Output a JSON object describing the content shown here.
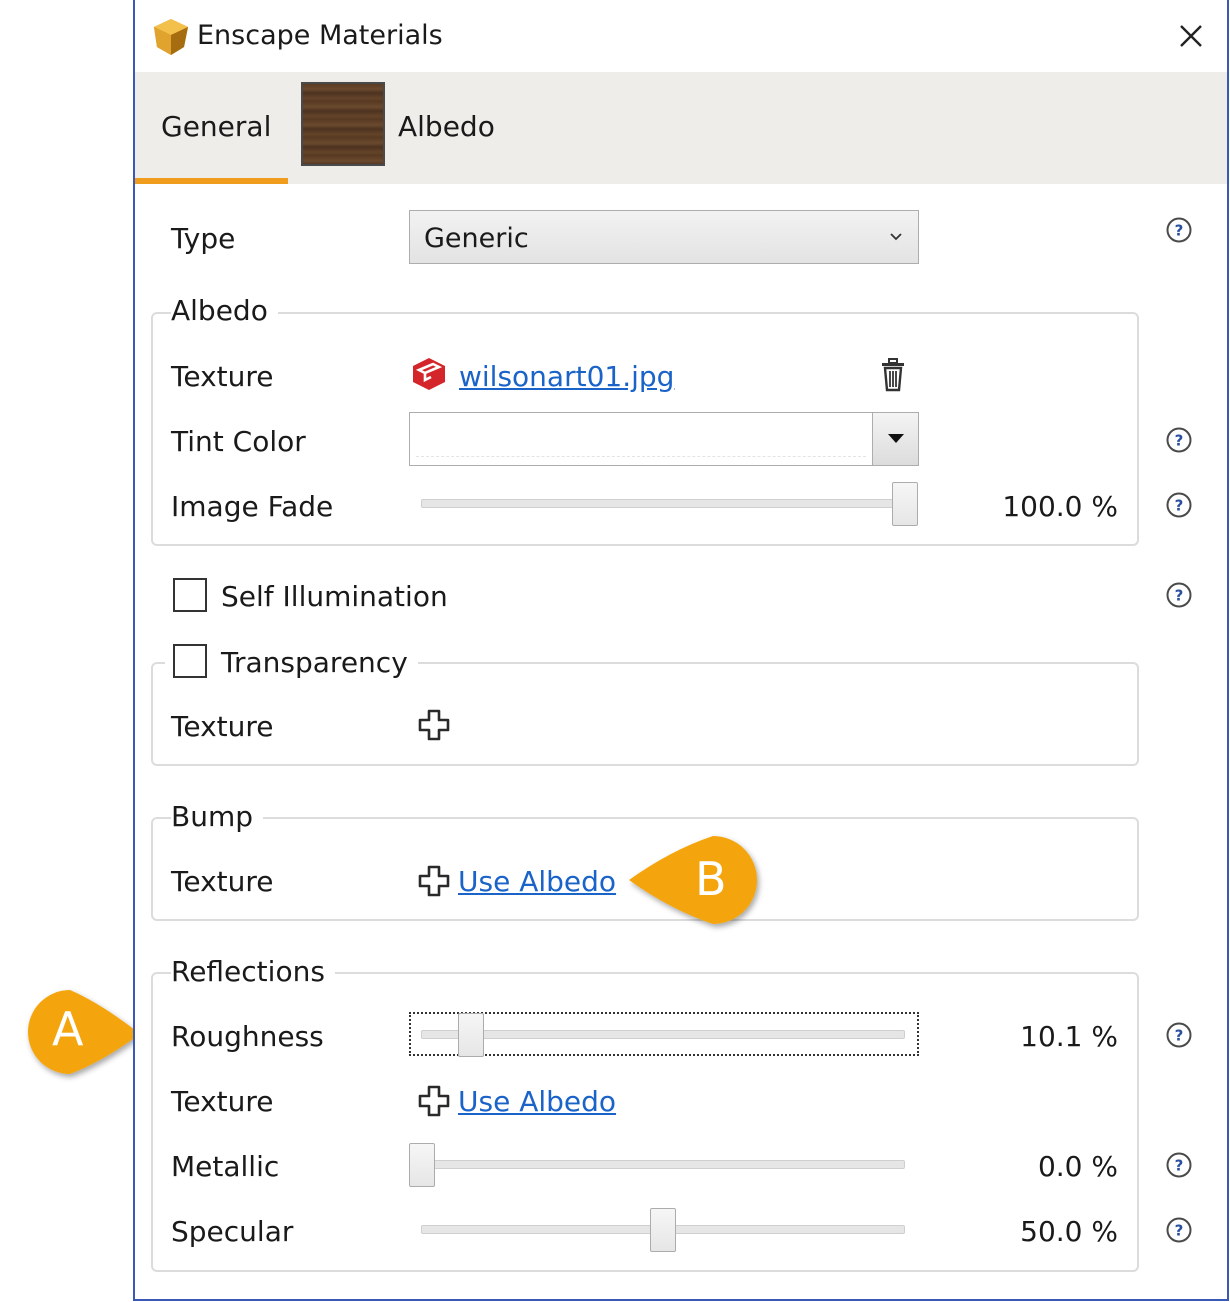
{
  "window": {
    "title": "Enscape Materials"
  },
  "tabs": [
    {
      "label": "General",
      "active": true
    },
    {
      "label": "Albedo",
      "active": false
    }
  ],
  "type_row": {
    "label": "Type",
    "value": "Generic"
  },
  "albedo": {
    "title": "Albedo",
    "texture_label": "Texture",
    "texture_file": "wilsonart01.jpg",
    "tint_label": "Tint Color",
    "image_fade_label": "Image Fade",
    "image_fade_value": "100.0 %",
    "image_fade_fraction": 1.0
  },
  "self_illumination": {
    "label": "Self Illumination",
    "checked": false
  },
  "transparency": {
    "label": "Transparency",
    "checked": false,
    "texture_label": "Texture"
  },
  "bump": {
    "title": "Bump",
    "texture_label": "Texture",
    "link": "Use Albedo"
  },
  "reflections": {
    "title": "Reflections",
    "roughness_label": "Roughness",
    "roughness_value": "10.1 %",
    "roughness_fraction": 0.101,
    "texture_label": "Texture",
    "texture_link": "Use Albedo",
    "metallic_label": "Metallic",
    "metallic_value": "0.0 %",
    "metallic_fraction": 0.0,
    "specular_label": "Specular",
    "specular_value": "50.0 %",
    "specular_fraction": 0.5
  },
  "callouts": {
    "a": "A",
    "b": "B"
  },
  "colors": {
    "accent": "#f09c1c",
    "link": "#1a63c8",
    "window_border": "#3a58b5",
    "callout": "#f4a50e"
  }
}
